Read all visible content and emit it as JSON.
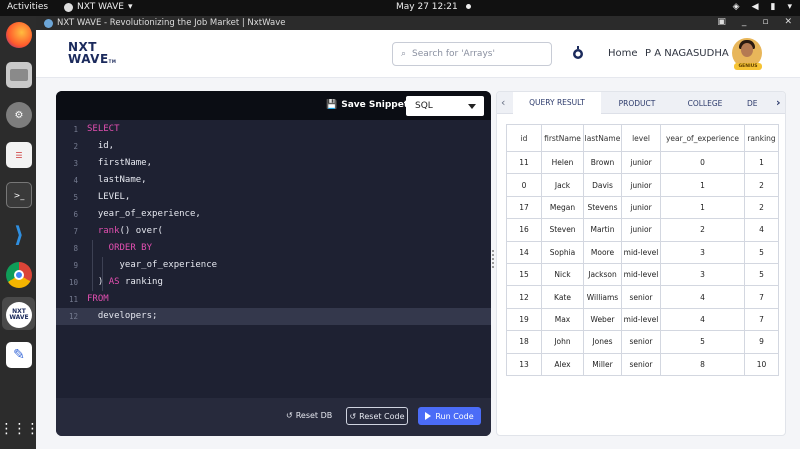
{
  "os": {
    "activities": "Activities",
    "app_name": "NXT WAVE",
    "clock": "May 27  12:21"
  },
  "browser": {
    "title": "NXT WAVE - Revolutionizing the Job Market | NxtWave"
  },
  "header": {
    "logo_line1": "NXT",
    "logo_line2": "WAVE",
    "logo_tm": "TM",
    "search_placeholder": "Search for 'Arrays'",
    "home": "Home",
    "user_name": "P A NAGASUDHA",
    "badge": "GENIUS"
  },
  "editor": {
    "save_label": "Save Snippet",
    "language": "SQL",
    "lines": [
      {
        "n": "1",
        "tokens": [
          {
            "t": "SELECT",
            "k": true
          }
        ]
      },
      {
        "n": "2",
        "tokens": [
          {
            "t": "  id,",
            "k": false
          }
        ]
      },
      {
        "n": "3",
        "tokens": [
          {
            "t": "  firstName,",
            "k": false
          }
        ]
      },
      {
        "n": "4",
        "tokens": [
          {
            "t": "  lastName,",
            "k": false
          }
        ]
      },
      {
        "n": "5",
        "tokens": [
          {
            "t": "  LEVEL,",
            "k": false
          }
        ]
      },
      {
        "n": "6",
        "tokens": [
          {
            "t": "  year_of_experience,",
            "k": false
          }
        ]
      },
      {
        "n": "7",
        "tokens": [
          {
            "t": "  rank",
            "k": true
          },
          {
            "t": "() over(",
            "k": false
          }
        ]
      },
      {
        "n": "8",
        "tokens": [
          {
            "t": "    ORDER BY",
            "k": true
          }
        ]
      },
      {
        "n": "9",
        "tokens": [
          {
            "t": "      year_of_experience",
            "k": false
          }
        ]
      },
      {
        "n": "10",
        "tokens": [
          {
            "t": "  ) ",
            "k": false
          },
          {
            "t": "AS",
            "k": true
          },
          {
            "t": " ranking",
            "k": false
          }
        ]
      },
      {
        "n": "11",
        "tokens": [
          {
            "t": "FROM",
            "k": true
          }
        ]
      },
      {
        "n": "12",
        "tokens": [
          {
            "t": "  developers;",
            "k": false
          }
        ]
      }
    ],
    "reset_db": "Reset DB",
    "reset_code": "Reset Code",
    "run_code": "Run Code"
  },
  "result": {
    "tabs": [
      "QUERY RESULT",
      "PRODUCT",
      "COLLEGE",
      "DE"
    ],
    "columns": [
      "id",
      "firstName",
      "lastName",
      "level",
      "year_of_experience",
      "ranking"
    ],
    "rows": [
      [
        "11",
        "Helen",
        "Brown",
        "junior",
        "0",
        "1"
      ],
      [
        "0",
        "Jack",
        "Davis",
        "junior",
        "1",
        "2"
      ],
      [
        "17",
        "Megan",
        "Stevens",
        "junior",
        "1",
        "2"
      ],
      [
        "16",
        "Steven",
        "Martin",
        "junior",
        "2",
        "4"
      ],
      [
        "14",
        "Sophia",
        "Moore",
        "mid-level",
        "3",
        "5"
      ],
      [
        "15",
        "Nick",
        "Jackson",
        "mid-level",
        "3",
        "5"
      ],
      [
        "12",
        "Kate",
        "Williams",
        "senior",
        "4",
        "7"
      ],
      [
        "19",
        "Max",
        "Weber",
        "mid-level",
        "4",
        "7"
      ],
      [
        "18",
        "John",
        "Jones",
        "senior",
        "5",
        "9"
      ],
      [
        "13",
        "Alex",
        "Miller",
        "senior",
        "8",
        "10"
      ]
    ]
  }
}
